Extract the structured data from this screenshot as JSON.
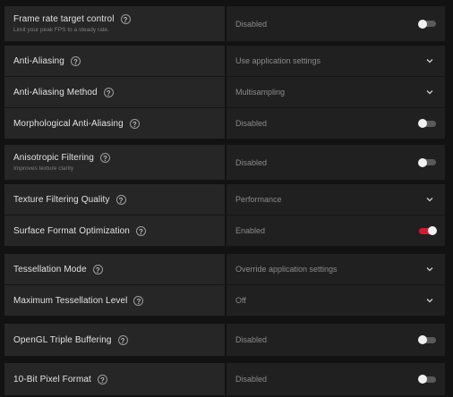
{
  "settings": [
    {
      "title": "Frame rate target control",
      "subtitle": "Limit your peak FPS to a steady rate.",
      "value": "Disabled",
      "control": "toggle",
      "enabled": false
    },
    {
      "title": "Anti-Aliasing",
      "value": "Use application settings",
      "control": "dropdown"
    },
    {
      "title": "Anti-Aliasing Method",
      "value": "Multisampling",
      "control": "dropdown"
    },
    {
      "title": "Morphological Anti-Aliasing",
      "value": "Disabled",
      "control": "toggle",
      "enabled": false
    },
    {
      "title": "Anisotropic Filtering",
      "subtitle": "Improves texture clarity",
      "value": "Disabled",
      "control": "toggle",
      "enabled": false
    },
    {
      "title": "Texture Filtering Quality",
      "value": "Performance",
      "control": "dropdown"
    },
    {
      "title": "Surface Format Optimization",
      "value": "Enabled",
      "control": "toggle",
      "enabled": true
    },
    {
      "title": "Tessellation Mode",
      "value": "Override application settings",
      "control": "dropdown"
    },
    {
      "title": "Maximum Tessellation Level",
      "value": "Off",
      "control": "dropdown"
    },
    {
      "title": "OpenGL Triple Buffering",
      "value": "Disabled",
      "control": "toggle",
      "enabled": false
    },
    {
      "title": "10-Bit Pixel Format",
      "value": "Disabled",
      "control": "toggle",
      "enabled": false
    }
  ],
  "icons": {
    "help": "help-circle-icon",
    "dropdown": "chevron-down-icon",
    "toggle": "toggle-switch"
  },
  "colors": {
    "background": "#121212",
    "label_cell": "#262626",
    "value_cell": "#202020",
    "accent": "#d31a33",
    "toggle_off": "#5a5a5a"
  }
}
